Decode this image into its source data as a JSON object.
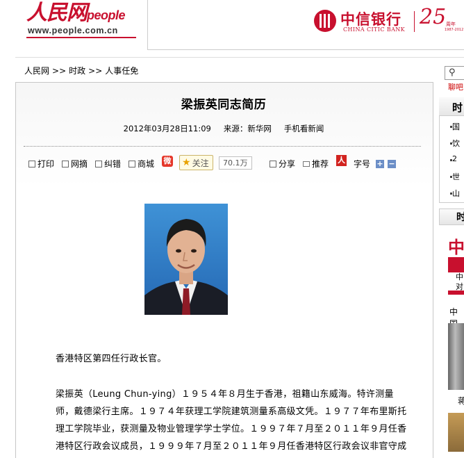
{
  "header": {
    "logo_text": "人民网",
    "logo_latin": "people",
    "logo_url": "www.people.com.cn",
    "bank_name_zh": "中信银行",
    "bank_name_en": "CHINA CITIC BANK",
    "anniversary_number": "25",
    "anniversary_label": "周年",
    "anniversary_years": "1987-2012"
  },
  "breadcrumb": {
    "items": [
      "人民网",
      "时政",
      "人事任免"
    ],
    "separator": ">>"
  },
  "article": {
    "title": "梁振英同志简历",
    "datetime": "2012年03月28日11:09",
    "source": "来源：新华网",
    "mobile_link": "手机看新闻",
    "toolbar": {
      "print": "打印",
      "excerpt": "网摘",
      "correction": "纠错",
      "shop": "商城",
      "follow": "关注",
      "follow_count": "70.1万",
      "share": "分享",
      "recommend": "推荐",
      "font_size": "字号",
      "plus": "+",
      "minus": "−"
    },
    "paragraphs": [
      "香港特区第四任行政长官。",
      "梁振英（Leung Chun-ying）１９５４年８月生于香港，祖籍山东威海。特许测量师，戴德梁行主席。１９７４年获理工学院建筑测量系高级文凭。１９７７年布里斯托理工学院毕业，获测量及物业管理学学士学位。１９９７年７月至２０１１年９月任香港特区行政会议成员，１９９９年７月至２０１１年９月任香港特区行政会议非官守成"
    ]
  },
  "sidebar": {
    "search_icon": "magnifier-icon",
    "chat_label": "聊吧",
    "box1_title": "时",
    "box1_items": [
      "国",
      "饮",
      "2",
      "世",
      "山"
    ],
    "box2_title": "时",
    "ad_title": "中",
    "ad_line1": "中",
    "ad_line2": "对",
    "section_label": "中国",
    "photo_caption": "蒋"
  },
  "colors": {
    "brand_red": "#c8102e",
    "border_gray": "#c6c6c6"
  }
}
